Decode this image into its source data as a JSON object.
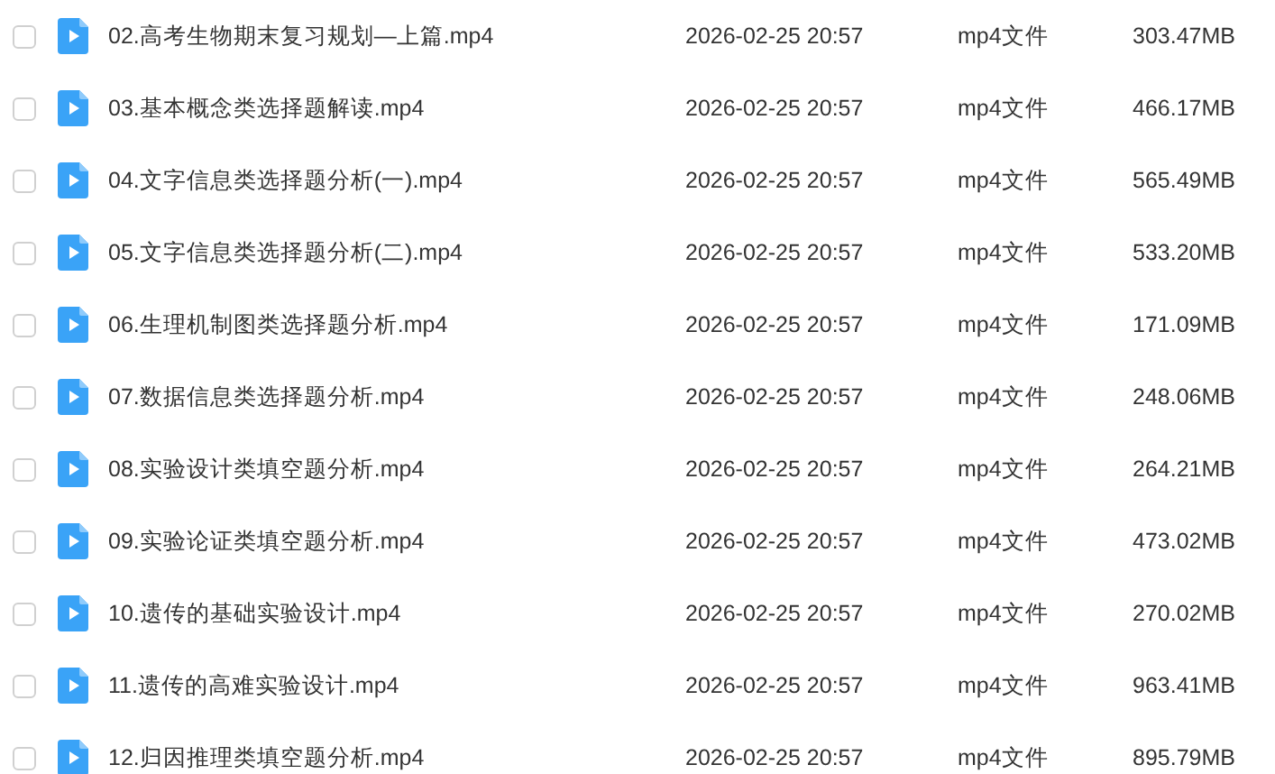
{
  "files": [
    {
      "name": "02.高考生物期末复习规划—上篇.mp4",
      "modified": "2026-02-25 20:57",
      "type": "mp4文件",
      "size": "303.47MB",
      "checked": false
    },
    {
      "name": "03.基本概念类选择题解读.mp4",
      "modified": "2026-02-25 20:57",
      "type": "mp4文件",
      "size": "466.17MB",
      "checked": false
    },
    {
      "name": "04.文字信息类选择题分析(一).mp4",
      "modified": "2026-02-25 20:57",
      "type": "mp4文件",
      "size": "565.49MB",
      "checked": false
    },
    {
      "name": "05.文字信息类选择题分析(二).mp4",
      "modified": "2026-02-25 20:57",
      "type": "mp4文件",
      "size": "533.20MB",
      "checked": false
    },
    {
      "name": "06.生理机制图类选择题分析.mp4",
      "modified": "2026-02-25 20:57",
      "type": "mp4文件",
      "size": "171.09MB",
      "checked": false
    },
    {
      "name": "07.数据信息类选择题分析.mp4",
      "modified": "2026-02-25 20:57",
      "type": "mp4文件",
      "size": "248.06MB",
      "checked": false
    },
    {
      "name": "08.实验设计类填空题分析.mp4",
      "modified": "2026-02-25 20:57",
      "type": "mp4文件",
      "size": "264.21MB",
      "checked": false
    },
    {
      "name": "09.实验论证类填空题分析.mp4",
      "modified": "2026-02-25 20:57",
      "type": "mp4文件",
      "size": "473.02MB",
      "checked": false
    },
    {
      "name": "10.遗传的基础实验设计.mp4",
      "modified": "2026-02-25 20:57",
      "type": "mp4文件",
      "size": "270.02MB",
      "checked": false
    },
    {
      "name": "11.遗传的高难实验设计.mp4",
      "modified": "2026-02-25 20:57",
      "type": "mp4文件",
      "size": "963.41MB",
      "checked": false
    },
    {
      "name": "12.归因推理类填空题分析.mp4",
      "modified": "2026-02-25 20:57",
      "type": "mp4文件",
      "size": "895.79MB",
      "checked": false
    }
  ]
}
